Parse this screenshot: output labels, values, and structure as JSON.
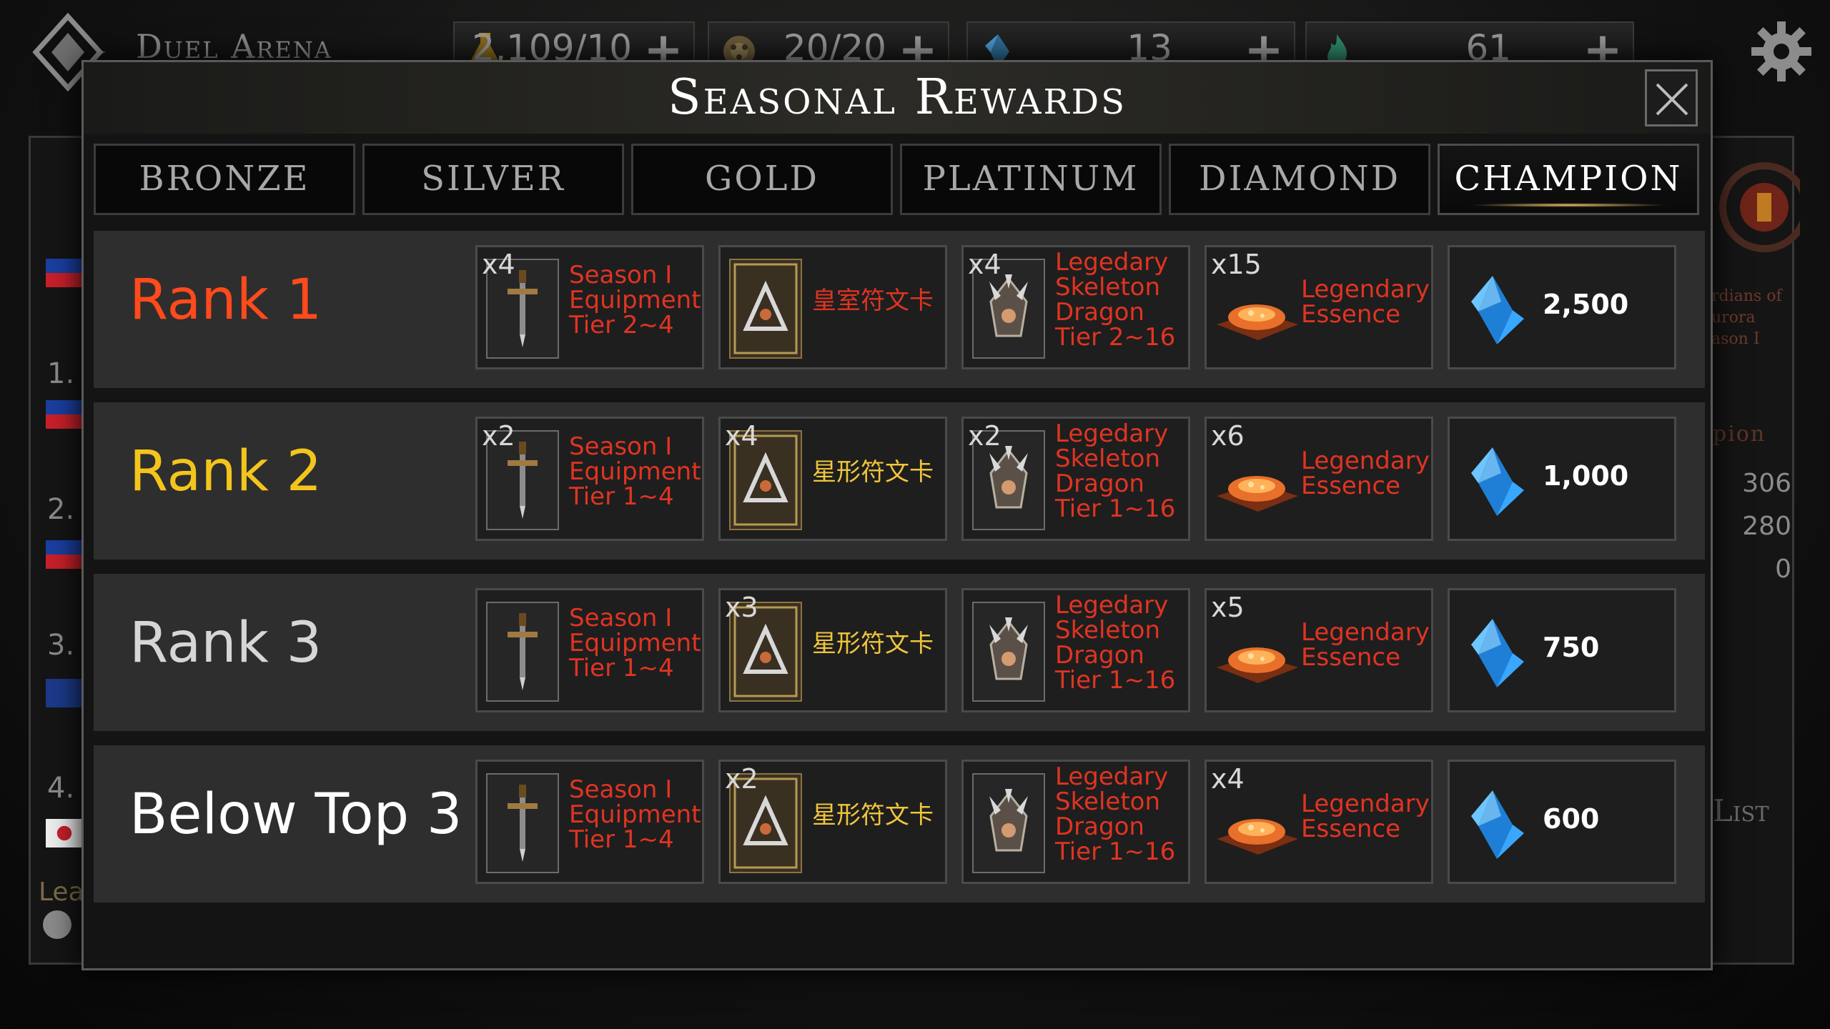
{
  "topbar": {
    "arena_title": "Duel Arena",
    "resources": [
      {
        "icon": "potion-icon",
        "value": "2,109/10"
      },
      {
        "icon": "shield-token-icon",
        "value": "20/20"
      },
      {
        "icon": "blue-crystal-icon",
        "value": "13"
      },
      {
        "icon": "green-flame-icon",
        "value": "61"
      }
    ],
    "plus_label": "+"
  },
  "background": {
    "left_numbers": [
      "1.",
      "2.",
      "3.",
      "4."
    ],
    "crest_text": "rdians of\nurora\nason I",
    "right_label": "pion",
    "right_numbers": [
      "306",
      "280",
      "0"
    ],
    "right_list": "List",
    "bottom_left": "Lea"
  },
  "modal": {
    "title": "Seasonal Rewards",
    "tabs": [
      {
        "label": "BRONZE",
        "active": false
      },
      {
        "label": "SILVER",
        "active": false
      },
      {
        "label": "GOLD",
        "active": false
      },
      {
        "label": "PLATINUM",
        "active": false
      },
      {
        "label": "DIAMOND",
        "active": false
      },
      {
        "label": "CHAMPION",
        "active": true
      }
    ],
    "ranks": [
      {
        "label": "Rank 1",
        "color": "#ff4a1c",
        "equipment": {
          "qty": "x4",
          "name": [
            "Season I",
            "Equipment",
            "Tier 2~4"
          ]
        },
        "card": {
          "qty": "",
          "name": "皇室符文卡",
          "color": "#e03422"
        },
        "dragon": {
          "qty": "x4",
          "name": [
            "Legedary",
            "Skeleton",
            "Dragon",
            "Tier 2~16"
          ]
        },
        "essence": {
          "qty": "x15",
          "name": [
            "Legendary",
            "Essence"
          ]
        },
        "gems": "2,500"
      },
      {
        "label": "Rank 2",
        "color": "#f3c51c",
        "equipment": {
          "qty": "x2",
          "name": [
            "Season I",
            "Equipment",
            "Tier 1~4"
          ]
        },
        "card": {
          "qty": "x4",
          "name": "星形符文卡",
          "color": "#f0c63a"
        },
        "dragon": {
          "qty": "x2",
          "name": [
            "Legedary",
            "Skeleton",
            "Dragon",
            "Tier 1~16"
          ]
        },
        "essence": {
          "qty": "x6",
          "name": [
            "Legendary",
            "Essence"
          ]
        },
        "gems": "1,000"
      },
      {
        "label": "Rank 3",
        "color": "#d6d6d6",
        "equipment": {
          "qty": "",
          "name": [
            "Season I",
            "Equipment",
            "Tier 1~4"
          ]
        },
        "card": {
          "qty": "x3",
          "name": "星形符文卡",
          "color": "#f0c63a"
        },
        "dragon": {
          "qty": "",
          "name": [
            "Legedary",
            "Skeleton",
            "Dragon",
            "Tier 1~16"
          ]
        },
        "essence": {
          "qty": "x5",
          "name": [
            "Legendary",
            "Essence"
          ]
        },
        "gems": "750"
      },
      {
        "label": "Below Top 3",
        "color": "#ffffff",
        "equipment": {
          "qty": "",
          "name": [
            "Season I",
            "Equipment",
            "Tier 1~4"
          ]
        },
        "card": {
          "qty": "x2",
          "name": "星形符文卡",
          "color": "#f0c63a"
        },
        "dragon": {
          "qty": "",
          "name": [
            "Legedary",
            "Skeleton",
            "Dragon",
            "Tier 1~16"
          ]
        },
        "essence": {
          "qty": "x4",
          "name": [
            "Legendary",
            "Essence"
          ]
        },
        "gems": "600"
      }
    ]
  },
  "colors": {
    "reward_name_red": "#e03422",
    "card_name_gold": "#f0c63a",
    "tab_active_glow": "#f3c66b",
    "gem_blue": "#3aa7ff"
  }
}
